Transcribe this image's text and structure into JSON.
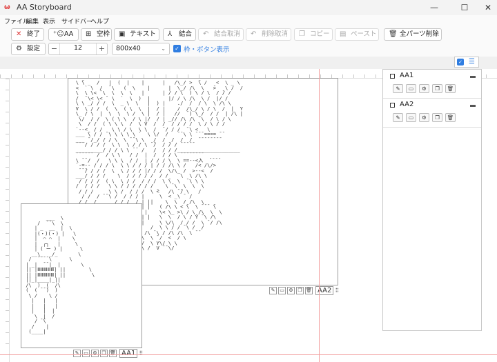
{
  "window": {
    "title": "AA Storyboard",
    "app_icon": "ω",
    "controls": {
      "minimize": "—",
      "maximize": "☐",
      "close": "✕"
    }
  },
  "menu": [
    "ファイル",
    "編集",
    "表示",
    "サイドバー",
    "ヘルプ"
  ],
  "toolbar": {
    "row1": [
      {
        "label": "終了",
        "icon": "close-icon",
        "glyph": "✕",
        "disabled": false,
        "red": true
      },
      {
        "label": "AA",
        "icon": "add-user-icon",
        "glyph": "⁺☺",
        "disabled": false
      },
      {
        "label": "空枠",
        "icon": "add-square-icon",
        "glyph": "⊞",
        "disabled": false
      },
      {
        "label": "テキスト",
        "icon": "comment-icon",
        "glyph": "▣",
        "disabled": false
      },
      {
        "label": "結合",
        "icon": "merge-icon",
        "glyph": "⅄",
        "disabled": false
      },
      {
        "label": "結合取消",
        "icon": "undo-icon",
        "glyph": "↶",
        "disabled": true
      },
      {
        "label": "削除取消",
        "icon": "undo-icon",
        "glyph": "↶",
        "disabled": true
      },
      {
        "label": "コピー",
        "icon": "copy-icon",
        "glyph": "❐",
        "disabled": true
      },
      {
        "label": "ペースト",
        "icon": "paste-icon",
        "glyph": "▤",
        "disabled": true
      },
      {
        "label": "全パーツ削除",
        "icon": "trash-icon",
        "glyph": "🗑",
        "disabled": false
      }
    ],
    "settings_label": "設定",
    "font_size": "12",
    "canvas_size": "800x40",
    "show_frame_checked": true,
    "show_frame_label": "枠・ボタン表示"
  },
  "parts": [
    {
      "name": "AA2"
    },
    {
      "name": "AA1"
    }
  ],
  "layers": [
    {
      "name": "AA1"
    },
    {
      "name": "AA2"
    }
  ],
  "part_buttons": [
    "✎",
    "▭",
    "⚙",
    "❐",
    "🗑"
  ],
  "aa2_art": "  \\ ̄\\ _  /   |  (  |    |      |   /\\_/ >  ̄\\ /   <  \\ _ \\\n  <  ` \\  /  ̄ \\   (  \\    |      |  \\_/ /\\  \\   ̄>   \\ /  /\n  \\  \\ \\< ̄ \\  \\  \\  \\   |      | / / \\  ) \\ / \\  / ̄/ /\n  /  ̄ \\< \\< ̄  \\  `  \\  )  |      |/ / \\ /\\  \\ /  |/ /\n  \\ \\ _/ / /  \\  _ \\  \\   |  ) |    ./  /  / \\  \\ /\\ \\\n  V  \\ / /  (  \\  ( \\  \\  |  / |    /  /\\_/ \\ / \\  /  |  Y\n  \\_ / \\  |  \\  \\  \\ /  \\ |  / |   //  ̄ ) \\_/  / /  | /\\ |\n   \\/  / /  \\ ( \\ \\  / \\ |/  / | _// /\\ /\\ ̄ \\  / \\ / \\\n   \\  / /  ( \\ \\ \\  /  \\ V  /  /  / / / /  \\ / \\ / /\n  `--<  / /   \\ \\ / \\  \\ \\  /  ̄ / / /  ̄ \\ <   \\\n  ___ ̄\\ / / ̄ \\ \\ \\ \\ \\ `  \\ \\/  /   ̄ ̄ \\ \\ ̄ ̄ ̄ ==== ̄ ̄\n  ___ ̄ /_/ / / \\  \\ ̄ ̄ \\ \\   /  /  /  /  /  ̄ ̄ ̄ ̄ ̄ ̄ ̄ ̄\n  ̄ ̄ ̄ / / / /  \\ \\  \\ / / \\ ̄ ̄/  / ̄/ / ̄ ̄ ̄ ̄ ̄\n  _________/ / / \\ \\ ̄ ̄  /   /  / / /_____________________\n  ̄ ̄ ̄ ̄ ̄ ̄  /  / \\ \\   / /  |  /  / / \\ ̄ ̄ ̄ ̄ ̄ ̄ ̄ ̄\n  \\ ̄ ̄ /  /   \\ \\ \\  / /  | / / / \\  \\ ==--<入  ̄ ̄ ̄ ̄ \n  `-=-- / / / \\  \\ \\ / / / | / / /\\ \\ /   /< /\\/>\n   ̄ ̄ ̄/ / / /  \\  \\ / / / |/ / /  \\/\\_ /  >--<  /\n  ___/ / / /    \\  / / / / /  / /    \\  \\ /\\ \\\n   / / / /  ( \\  \\ / /  / / /  \\ ̄\\  \\  ̄ \\ \\ \\\n  /  / / /   \\ \\ / / / / / /    \\ ̄ \\  \\  \\  \\\n   / / /     \\ \\ /  / / /  \\ ̄<   /\\ ̄ ̄/ \\   /\n    / /  / ̄ ̄ \\ /  / / / |     \\  < _\\ ̄  /\n   / /  /      / / /  / | ||    \\  \\  / /\\  \\\n  / /  /  \\ ̄ ̄ / / / |  || |   ( /\\ \\ < ̄\\  \\ ̄ ̄ ̄  ̄\\\n   / / (  _<  / / |  ||  |    \\< \\_ >\\ / \\ /\\  \\  \\\n  /  / \\ ̄ \\ / /  |  ||  | |   \\  \\  / \\ / ̄Y ̄ \\ /\\\n    / /  /  / /  |  |   |     \\ \\/\\  / / /  \\ ̄ / /\\\n   / /  /  /  |  |   |     /  \\ \\ / / ̄ \\ /  /\n    /  / /  |  |    |    /\\ ̄ \\ / /\\ /\\  \\ ̄ ̄\n   /  /  |  |    |   /  \\  \\ ̄ /  <  / \\\n      |  |     |  /   \\_/  \\ Y\\/ \\ \\\n     |   |    | /       \\ /  V ̄ ̄ \\/\n",
  "aa1_art": "\n\n        ___  \\\n     /  ̄ ̄ \\  \\\n    | _  __  |  \\\n    |(・)(・) |   \\\n    |  ⌒ ⌒  |    \\\n    |  ┌┐   |     \\\n    | ( ー ) |      \\\n   __\\_  _/_       \\\n  /  ̄ ̄ ̄ ̄ \\      \\\n | _|  ̄ ̄ |_ |       \\\n || |ⅢⅢⅢⅢⅢ| ||        \\\n || |ⅢⅢⅢⅢⅢ| ||         \\\n ||_|____|_||\n /\\  )  (  /\\\n (  ( ̄ ̄ ̄)  )\n  \\ /    \\ /\n   |   |   |\n   |   |   |\n   |   |  |\n    \\  |  /\n    / ̄ ̄\\\n   /    |\n  (____|\n"
}
